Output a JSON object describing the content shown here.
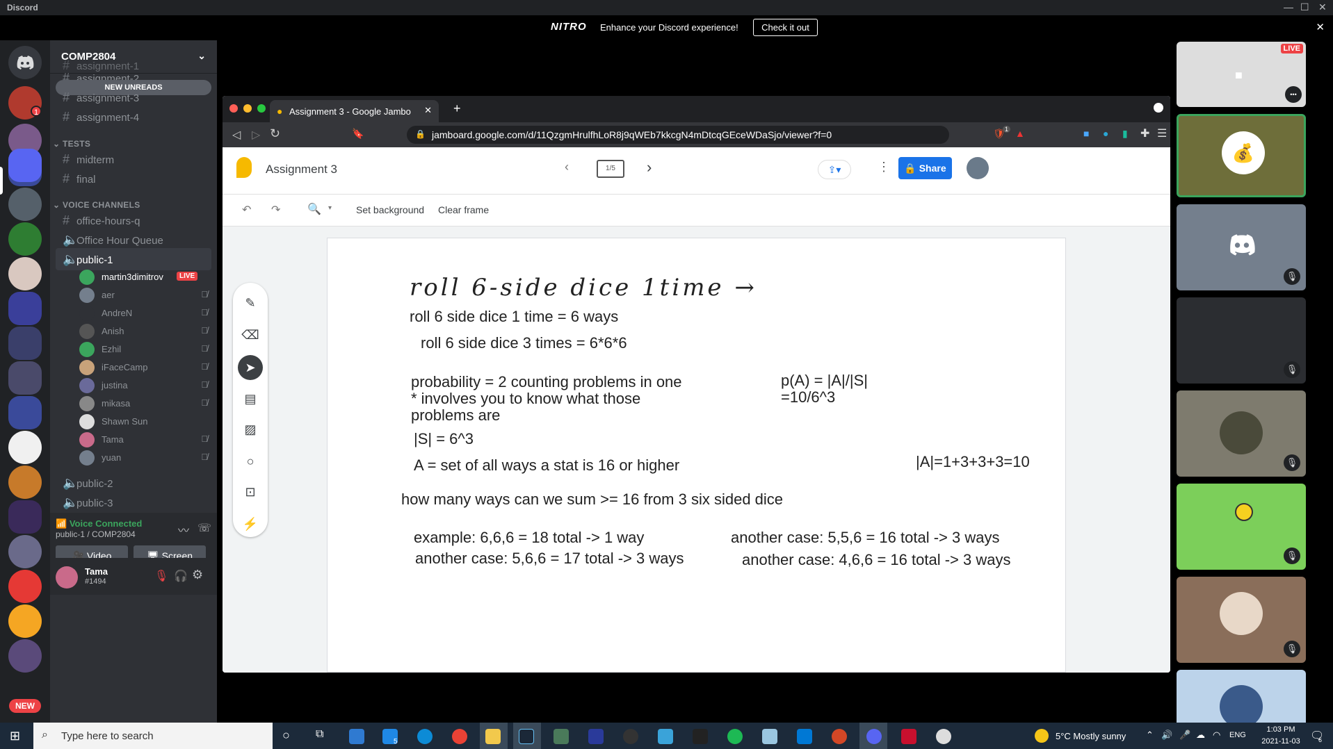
{
  "window": {
    "title": "Discord",
    "controls": [
      "—",
      "☐",
      "✕"
    ]
  },
  "nitro": {
    "logo": "NITRO",
    "message": "Enhance your Discord experience!",
    "cta": "Check it out",
    "close": "✕"
  },
  "server": {
    "name": "COMP2804",
    "rail_badge": "1",
    "new_badge": "NEW"
  },
  "channels": {
    "new_unreads": "NEW UNREADS",
    "top": [
      "assignment-1",
      "assignment-2",
      "assignment-3",
      "assignment-4"
    ],
    "tests_category": "TESTS",
    "tests": [
      "midterm",
      "final"
    ],
    "voice_category": "VOICE CHANNELS",
    "voice_text": [
      "office-hours-q"
    ],
    "voice": [
      "Office Hour Queue",
      "public-1",
      "public-2",
      "public-3"
    ],
    "live_badge": "LIVE",
    "users": [
      "martin3dimitrov",
      "aer",
      "AndreN",
      "Anish",
      "Ezhil",
      "iFaceCamp",
      "justina",
      "mikasa",
      "Shawn Sun",
      "Tama",
      "yuan"
    ]
  },
  "voice_panel": {
    "status": "Voice Connected",
    "channel": "public-1 / COMP2804",
    "video": "Video",
    "screen": "Screen"
  },
  "user": {
    "name": "Tama",
    "tag": "#1494"
  },
  "browser": {
    "tab_title": "Assignment 3 - Google Jambo",
    "url": "jamboard.google.com/d/11QzgmHrulfhLoR8j9qWEb7kkcgN4mDtcqGEceWDaSjo/viewer?f=0",
    "shield_count": "1"
  },
  "jamboard": {
    "title": "Assignment 3",
    "frame_counter": "1/5",
    "share": "Share",
    "set_background": "Set background",
    "clear_frame": "Clear frame"
  },
  "board": {
    "handwriting": "roll  6-side  dice  1time →",
    "line1": "roll 6 side dice 1 time = 6 ways",
    "line2": "roll 6 side dice 3 times = 6*6*6",
    "line3a": "probability = 2 counting problems in one",
    "line3b": "* involves you to know what those",
    "line3c": "problems are",
    "pA1": "p(A) = |A|/|S|",
    "pA2": "=10/6^3",
    "s": "|S| = 6^3",
    "a": "A = set of all ways a stat is 16 or higher",
    "aval": "|A|=1+3+3+3=10",
    "q": "how many ways can we sum >= 16 from 3 six sided dice",
    "ex1": "example: 6,6,6 = 18 total -> 1 way",
    "ex2": "another case: 5,6,6 = 17 total -> 3 ways",
    "ex3": "another case: 5,5,6 = 16 total -> 3 ways",
    "ex4": "another case: 4,6,6 = 16 total -> 3 ways"
  },
  "video_tiles": {
    "live": "LIVE",
    "more": "•••"
  },
  "taskbar": {
    "search_placeholder": "Type here to search",
    "mail_badge": "5",
    "weather": "5°C  Mostly sunny",
    "lang": "ENG",
    "time": "1:03 PM",
    "date": "2021-11-03",
    "notif": "6"
  }
}
